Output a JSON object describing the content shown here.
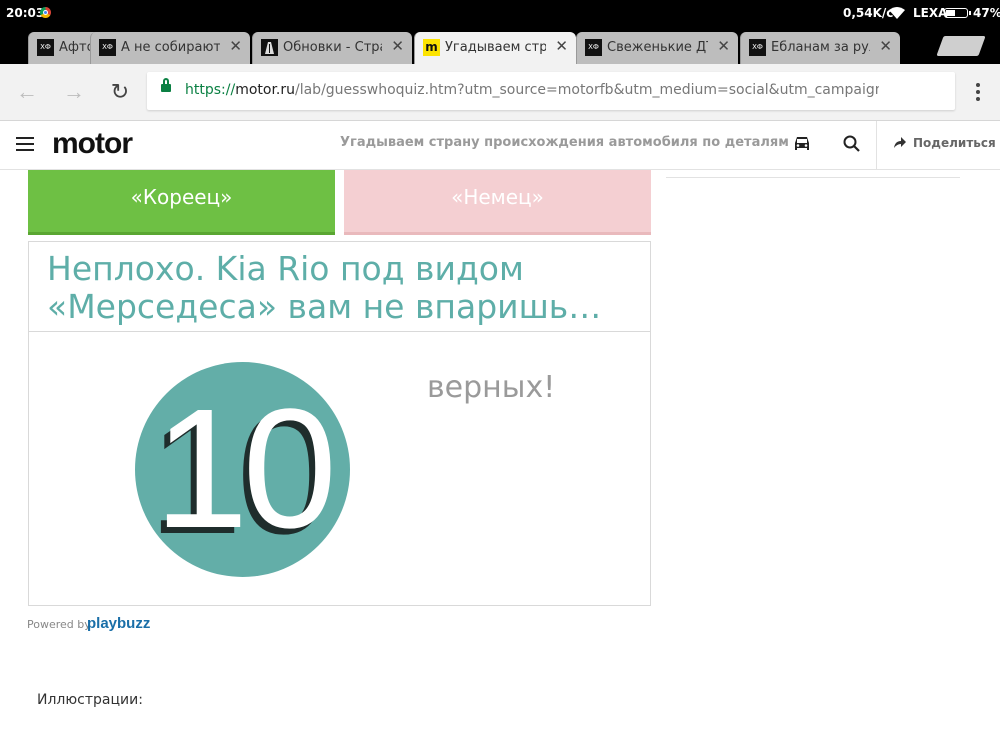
{
  "status_bar": {
    "time": "20:03",
    "net_speed": "0,54K/c",
    "carrier": "LEXA",
    "battery": "47%",
    "battery_level": 0.47
  },
  "tabs": [
    {
      "title": "Афтог",
      "favicon": "ХФ"
    },
    {
      "title": "А не собираются",
      "favicon": "ХФ"
    },
    {
      "title": "Обновки - Страни",
      "favicon": ""
    },
    {
      "title": "Угадываем стран",
      "favicon": "m",
      "active": true
    },
    {
      "title": "Свеженькие ДТП",
      "favicon": "ХФ"
    },
    {
      "title": "Ебланам за руле",
      "favicon": "ХФ"
    }
  ],
  "address_bar": {
    "scheme": "https://",
    "host": "motor.ru",
    "path": "/lab/guesswhoquiz.htm?utm_source=motorfb&utm_medium=social&utm_campaign=test-nedeli-razbira"
  },
  "site_header": {
    "logo": "motor",
    "title": "Угадываем страну происхождения автомобиля по деталям",
    "share_label": "Поделиться"
  },
  "quiz": {
    "answer_correct": "«Кореец»",
    "answer_wrong": "«Немец»",
    "result_headline": "Неплохо. Kia Rio под видом «Мерседеса» вам не впаришь…",
    "score": "10",
    "score_label": "верных!"
  },
  "footer": {
    "powered_by": "Powered by",
    "brand": "playbuzz",
    "illustrations": "Иллюстрации:"
  },
  "colors": {
    "correct": "#6ec044",
    "wrong": "#f4cfd2",
    "accent": "#63aea8"
  }
}
